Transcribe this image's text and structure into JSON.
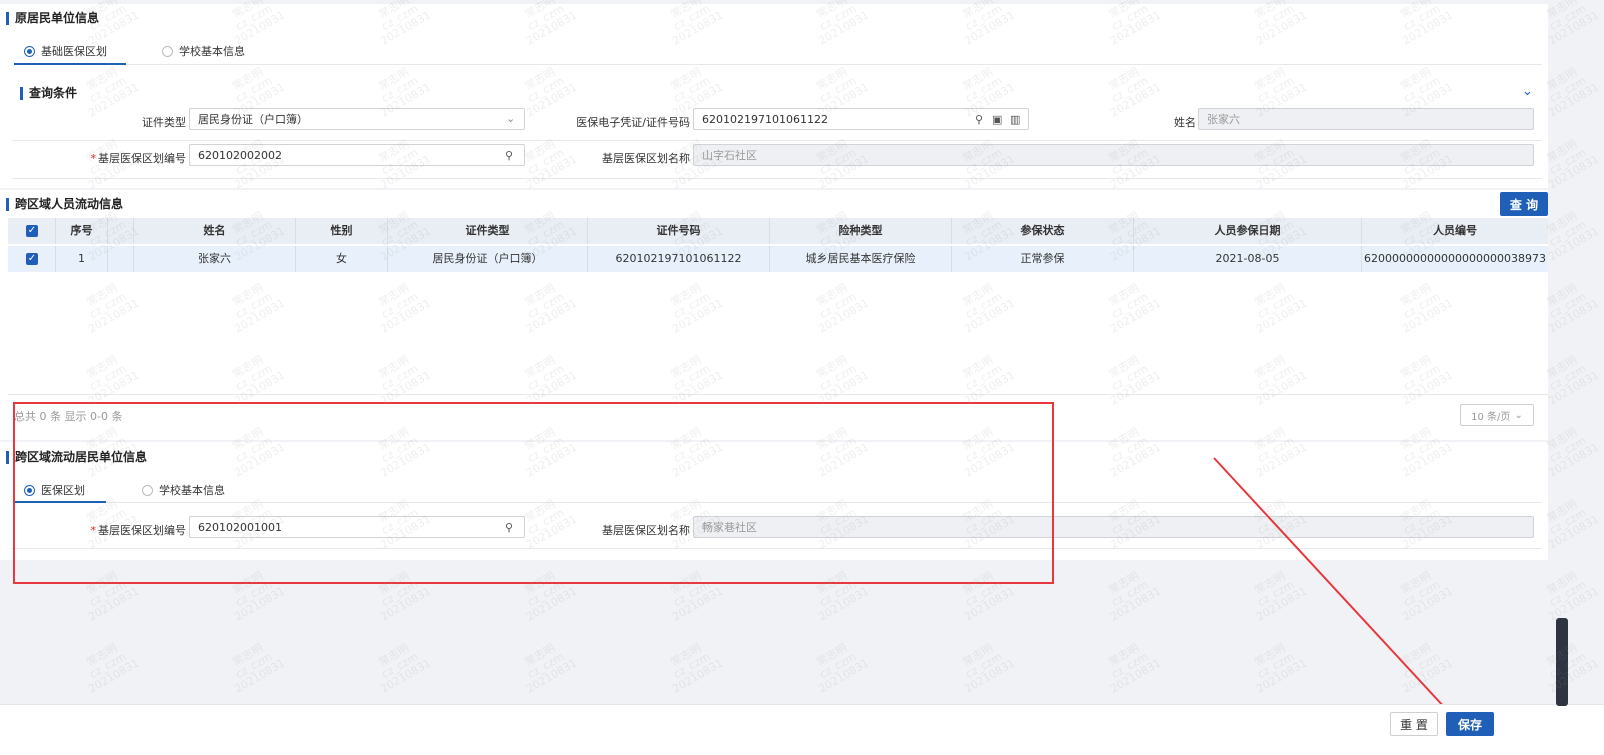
{
  "section1": {
    "title": "原居民单位信息",
    "tabs": [
      {
        "label": "基础医保区划",
        "selected": true
      },
      {
        "label": "学校基本信息",
        "selected": false
      }
    ],
    "query_title": "查询条件",
    "fields": {
      "id_type_label": "证件类型",
      "id_type_value": "居民身份证（户口簿）",
      "id_number_label": "医保电子凭证/证件号码",
      "id_number_value": "620102197101061122",
      "name_label": "姓名",
      "name_value": "张家六",
      "region_code_label": "基层医保区划编号",
      "region_code_value": "620102002002",
      "region_name_label": "基层医保区划名称",
      "region_name_value": "山字石社区"
    }
  },
  "section2": {
    "title": "跨区域人员流动信息",
    "query_button": "查 询",
    "columns": [
      "序号",
      "姓名",
      "性别",
      "证件类型",
      "证件号码",
      "险种类型",
      "参保状态",
      "人员参保日期",
      "人员编号"
    ],
    "rows": [
      [
        "1",
        "张家六",
        "女",
        "居民身份证（户口簿）",
        "620102197101061122",
        "城乡居民基本医疗保险",
        "正常参保",
        "2021-08-05",
        "62000000000000000000038973"
      ]
    ],
    "footer_text": "总共 0 条 显示 0-0 条",
    "page_size": "10 条/页"
  },
  "section3": {
    "title": "跨区域流动居民单位信息",
    "tabs": [
      {
        "label": "医保区划",
        "selected": true
      },
      {
        "label": "学校基本信息",
        "selected": false
      }
    ],
    "region_code_label": "基层医保区划编号",
    "region_code_value": "620102001001",
    "region_name_label": "基层医保区划名称",
    "region_name_value": "畅家巷社区"
  },
  "footer": {
    "reset_label": "重 置",
    "save_label": "保存"
  },
  "watermark": {
    "line1": "常志明",
    "line2": "cz_czm",
    "line3": "20210831"
  },
  "colors": {
    "accent": "#1f5fb8",
    "annotation_red": "#e8383d"
  }
}
